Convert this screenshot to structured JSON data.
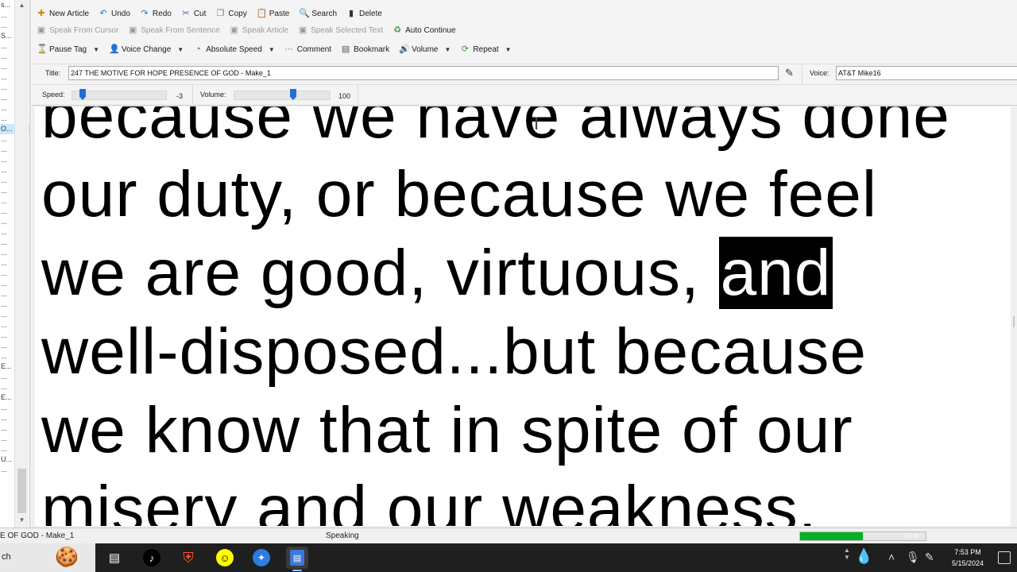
{
  "left_panel": {
    "rows": [
      "s...",
      "...",
      "...",
      "S...",
      "...",
      "...",
      "...",
      "...",
      "...",
      "...",
      "...",
      "...",
      "O...",
      "...",
      "...",
      "...",
      "...",
      "...",
      "...",
      "...",
      "...",
      "...",
      "...",
      "...",
      "...",
      "...",
      "...",
      "...",
      "...",
      "...",
      "...",
      "...",
      "...",
      "...",
      "...",
      "E...",
      "...",
      "...",
      "E...",
      "...",
      "...",
      "...",
      "...",
      "...",
      "U...",
      "..."
    ]
  },
  "toolbar": {
    "row1": [
      {
        "label": "New Article",
        "icon": "new-article-icon"
      },
      {
        "label": "Undo",
        "icon": "undo-icon"
      },
      {
        "label": "Redo",
        "icon": "redo-icon"
      },
      {
        "label": "Cut",
        "icon": "cut-icon"
      },
      {
        "label": "Copy",
        "icon": "copy-icon"
      },
      {
        "label": "Paste",
        "icon": "paste-icon"
      },
      {
        "label": "Search",
        "icon": "search-icon"
      },
      {
        "label": "Delete",
        "icon": "delete-icon"
      }
    ],
    "row2": [
      {
        "label": "Speak From Cursor",
        "disabled": true
      },
      {
        "label": "Speak From Sentence",
        "disabled": true
      },
      {
        "label": "Speak Article",
        "disabled": true
      },
      {
        "label": "Speak Selected Text",
        "disabled": true
      },
      {
        "label": "Auto Continue",
        "disabled": false
      }
    ],
    "row3": [
      {
        "label": "Pause Tag",
        "dropdown": true
      },
      {
        "label": "Voice Change",
        "dropdown": true
      },
      {
        "label": "Absolute Speed",
        "dropdown": true
      },
      {
        "label": "Comment",
        "dropdown": false
      },
      {
        "label": "Bookmark",
        "dropdown": false
      },
      {
        "label": "Volume",
        "dropdown": true
      },
      {
        "label": "Repeat",
        "dropdown": true
      }
    ]
  },
  "title_row": {
    "title_label": "Title:",
    "title_value": "247 THE MOTIVE FOR HOPE PRESENCE OF GOD - Make_1",
    "voice_label": "Voice:",
    "voice_value": "AT&T Mike16"
  },
  "speed_row": {
    "speed_label": "Speed:",
    "speed_value": "-3",
    "volume_label": "Volume:",
    "volume_value": "100"
  },
  "reader": {
    "lines": [
      {
        "before": "because we have always done",
        "highlight": "",
        "after": ""
      },
      {
        "before": "our duty, or because we feel",
        "highlight": "",
        "after": ""
      },
      {
        "before": "we are good, virtuous, ",
        "highlight": "and",
        "after": ""
      },
      {
        "before": "well-disposed...but because",
        "highlight": "",
        "after": ""
      },
      {
        "before": "we know that in spite of our",
        "highlight": "",
        "after": ""
      },
      {
        "before": "misery and our weakness,",
        "highlight": "",
        "after": ""
      }
    ]
  },
  "statusbar": {
    "title": "E OF GOD - Make_1",
    "state": "Speaking",
    "progress_label": "50 %",
    "progress": 0.5
  },
  "taskbar": {
    "search_stub": "ch",
    "apps": [
      "task-view-icon",
      "tiktok-icon",
      "brave-icon",
      "snapchat-icon",
      "app-blue-icon",
      "text-reader-icon"
    ],
    "time": "7:53 PM",
    "date": "5/15/2024"
  },
  "colors": {
    "progress_fill": "#06b025",
    "slider_thumb": "#1f6fd1",
    "highlight_bg": "#000000"
  }
}
